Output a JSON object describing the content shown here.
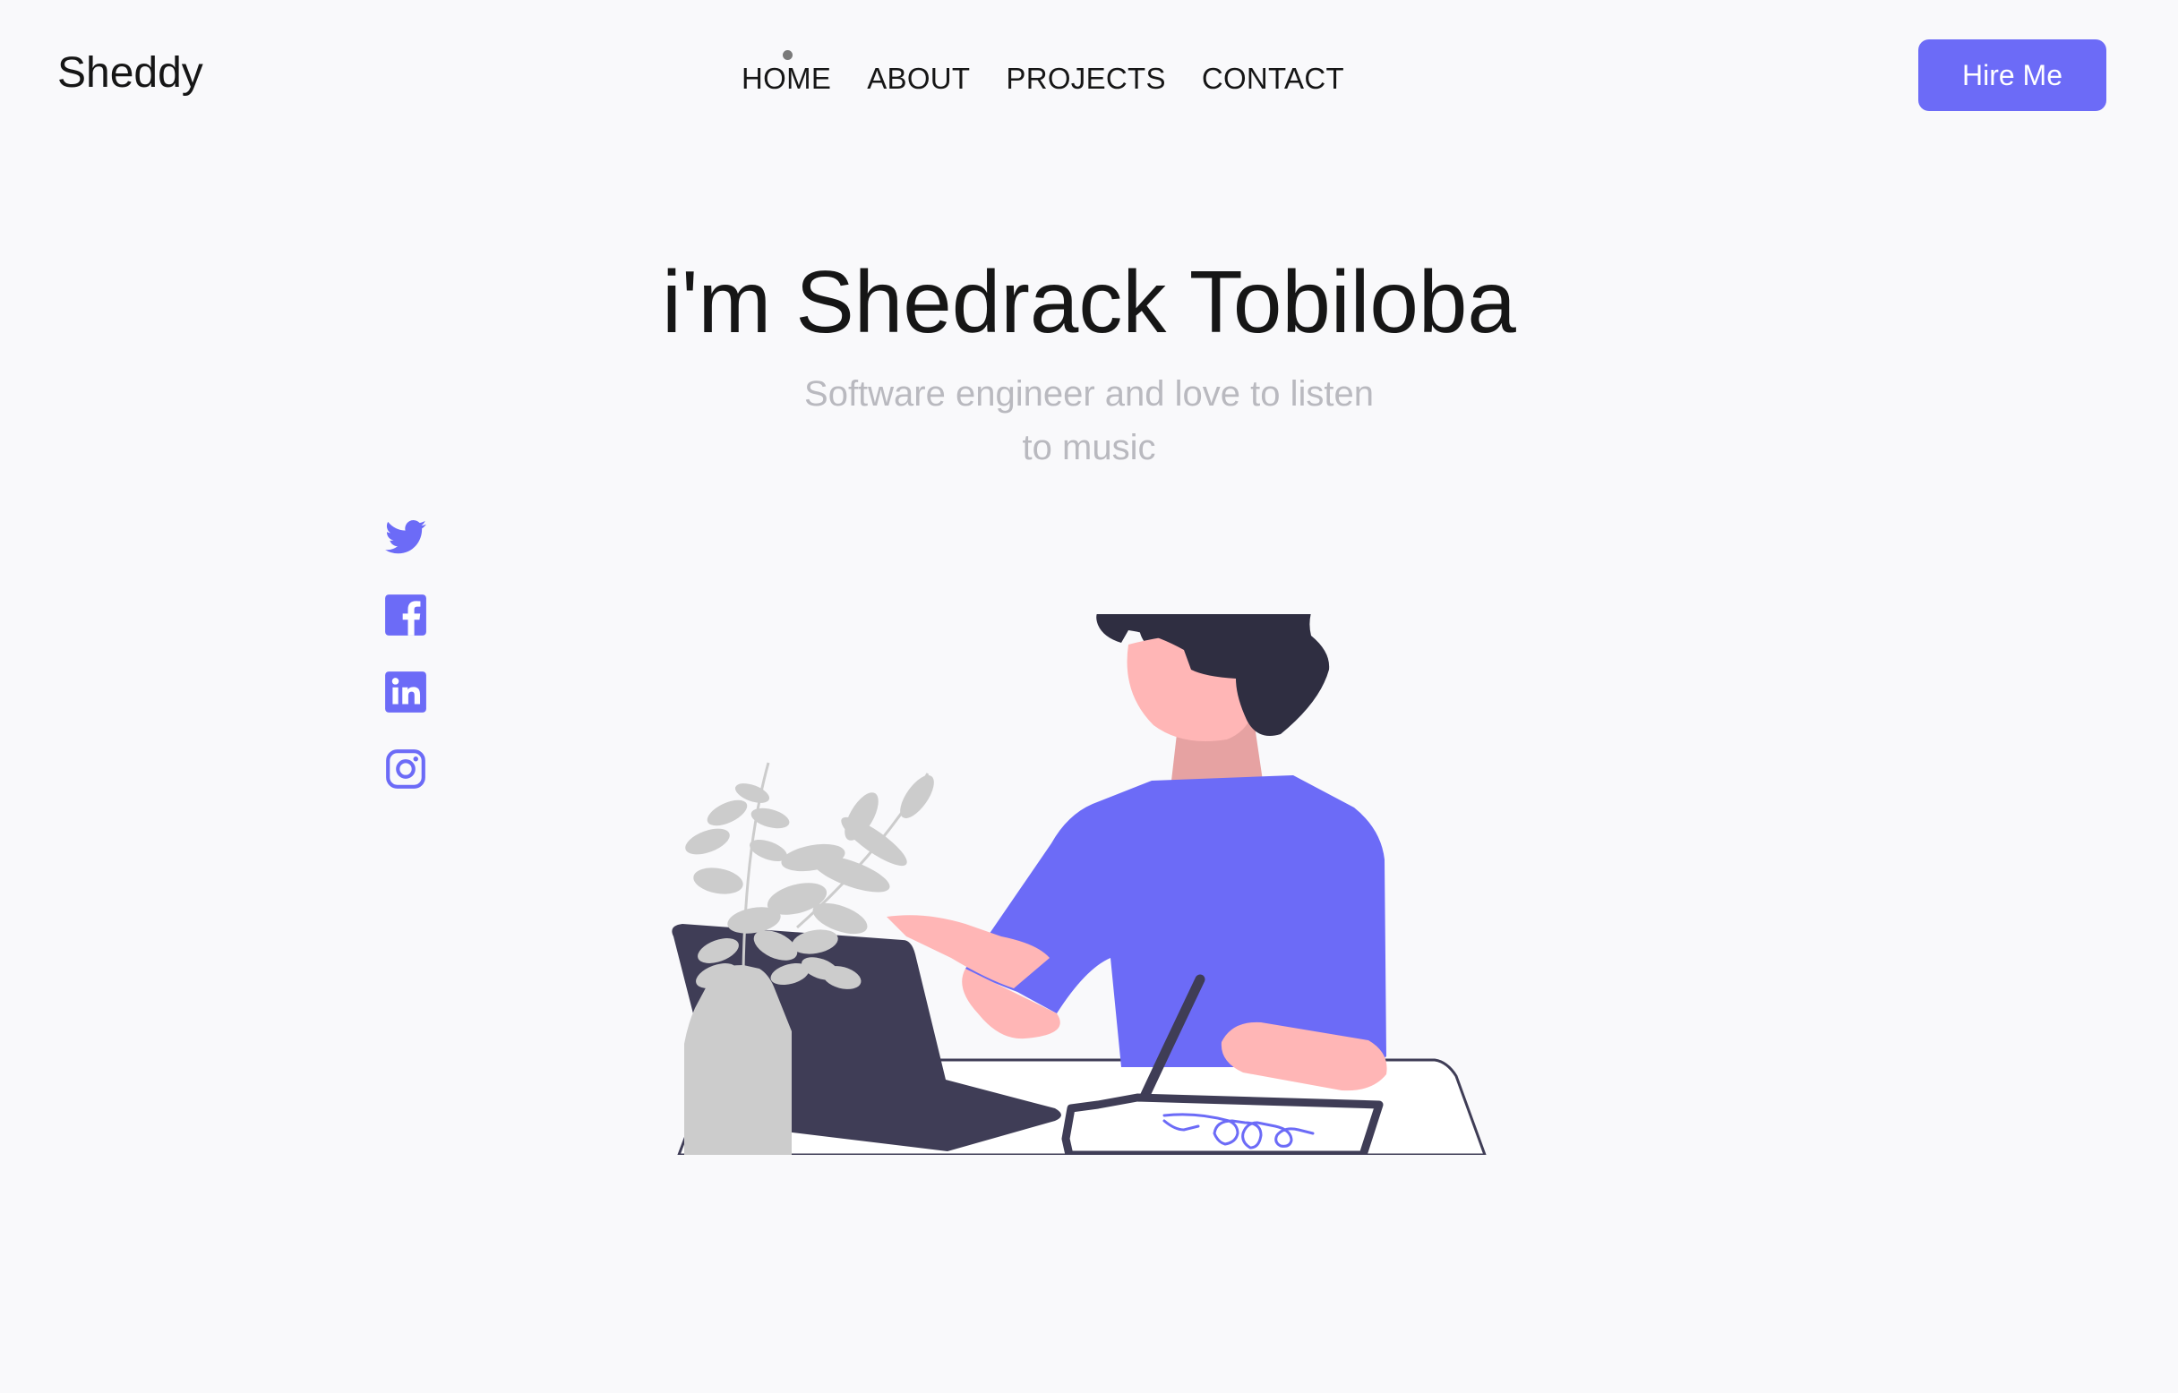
{
  "header": {
    "logo": "Sheddy",
    "nav": [
      {
        "label": "HOME",
        "active": true
      },
      {
        "label": "ABOUT",
        "active": false
      },
      {
        "label": "PROJECTS",
        "active": false
      },
      {
        "label": "CONTACT",
        "active": false
      }
    ],
    "cta_label": "Hire Me"
  },
  "hero": {
    "title": "i'm Shedrack Tobiloba",
    "subtitle_line1": "Software engineer and love to listen",
    "subtitle_line2": "to music"
  },
  "socials": [
    {
      "name": "twitter",
      "icon": "twitter-icon"
    },
    {
      "name": "facebook",
      "icon": "facebook-icon"
    },
    {
      "name": "linkedin",
      "icon": "linkedin-icon"
    },
    {
      "name": "instagram",
      "icon": "instagram-icon"
    }
  ],
  "colors": {
    "accent": "#6c6bf7",
    "background": "#f9f9fb",
    "text": "#161616",
    "muted": "#b9b9bf",
    "dark": "#3f3d56",
    "skin": "#ffb6b6",
    "plant": "#cccccc"
  }
}
